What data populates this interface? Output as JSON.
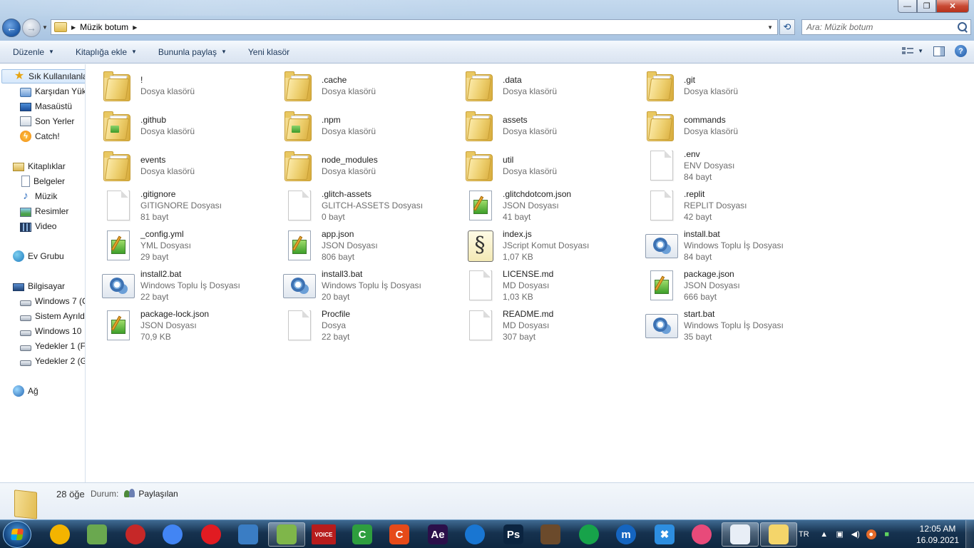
{
  "window": {
    "address_path": "Müzik botum",
    "search_placeholder": "Ara: Müzik botum",
    "minimize_symbol": "—",
    "maximize_symbol": "❐",
    "close_symbol": "✕"
  },
  "commands": [
    {
      "label": "Düzenle",
      "dropdown": true
    },
    {
      "label": "Kitaplığa ekle",
      "dropdown": true
    },
    {
      "label": "Bununla paylaş",
      "dropdown": true
    },
    {
      "label": "Yeni klasör",
      "dropdown": false
    }
  ],
  "nav": [
    {
      "label": "Sık Kullanılanlar",
      "icon": "star-icon",
      "level": 0,
      "selected": true
    },
    {
      "label": "Karşıdan Yük",
      "icon": "downloads-folder-icon",
      "level": 1
    },
    {
      "label": "Masaüstü",
      "icon": "desktop-icon",
      "level": 1
    },
    {
      "label": "Son Yerler",
      "icon": "recent-places-icon",
      "level": 1
    },
    {
      "label": "Catch!",
      "icon": "catch-icon",
      "level": 1
    },
    {
      "label": "Kitaplıklar",
      "icon": "libraries-icon",
      "level": 0
    },
    {
      "label": "Belgeler",
      "icon": "documents-icon",
      "level": 1
    },
    {
      "label": "Müzik",
      "icon": "music-icon",
      "level": 1
    },
    {
      "label": "Resimler",
      "icon": "pictures-icon",
      "level": 1
    },
    {
      "label": "Video",
      "icon": "video-icon",
      "level": 1
    },
    {
      "label": "Ev Grubu",
      "icon": "homegroup-icon",
      "level": 0
    },
    {
      "label": "Bilgisayar",
      "icon": "computer-icon",
      "level": 0
    },
    {
      "label": "Windows 7 (C",
      "icon": "windows-drive-icon",
      "level": 1
    },
    {
      "label": "Sistem Ayrıld",
      "icon": "drive-icon",
      "level": 1
    },
    {
      "label": "Windows 10",
      "icon": "drive-icon",
      "level": 1
    },
    {
      "label": "Yedekler 1 (F",
      "icon": "drive-icon",
      "level": 1
    },
    {
      "label": "Yedekler 2 (G",
      "icon": "drive-icon",
      "level": 1
    },
    {
      "label": "Ağ",
      "icon": "network-icon",
      "level": 0
    }
  ],
  "files": [
    {
      "name": "!",
      "type": "Dosya klasörü",
      "size": "",
      "icon": "folder-icon"
    },
    {
      "name": ".cache",
      "type": "Dosya klasörü",
      "size": "",
      "icon": "folder-icon"
    },
    {
      "name": ".data",
      "type": "Dosya klasörü",
      "size": "",
      "icon": "folder-icon"
    },
    {
      "name": ".git",
      "type": "Dosya klasörü",
      "size": "",
      "icon": "folder-icon"
    },
    {
      "name": ".github",
      "type": "Dosya klasörü",
      "size": "",
      "icon": "folder-icon"
    },
    {
      "name": ".npm",
      "type": "Dosya klasörü",
      "size": "",
      "icon": "folder-icon"
    },
    {
      "name": "assets",
      "type": "Dosya klasörü",
      "size": "",
      "icon": "folder-icon"
    },
    {
      "name": "commands",
      "type": "Dosya klasörü",
      "size": "",
      "icon": "folder-icon"
    },
    {
      "name": "events",
      "type": "Dosya klasörü",
      "size": "",
      "icon": "folder-icon"
    },
    {
      "name": "node_modules",
      "type": "Dosya klasörü",
      "size": "",
      "icon": "folder-icon"
    },
    {
      "name": "util",
      "type": "Dosya klasörü",
      "size": "",
      "icon": "folder-icon"
    },
    {
      "name": ".env",
      "type": "ENV Dosyası",
      "size": "84 bayt",
      "icon": "blank-file-icon"
    },
    {
      "name": ".gitignore",
      "type": "GITIGNORE Dosyası",
      "size": "81 bayt",
      "icon": "blank-file-icon"
    },
    {
      "name": ".glitch-assets",
      "type": "GLITCH-ASSETS Dosyası",
      "size": "0 bayt",
      "icon": "blank-file-icon"
    },
    {
      "name": ".glitchdotcom.json",
      "type": "JSON Dosyası",
      "size": "41 bayt",
      "icon": "json-file-icon"
    },
    {
      "name": ".replit",
      "type": "REPLIT Dosyası",
      "size": "42 bayt",
      "icon": "blank-file-icon"
    },
    {
      "name": "_config.yml",
      "type": "YML Dosyası",
      "size": "29 bayt",
      "icon": "json-file-icon"
    },
    {
      "name": "app.json",
      "type": "JSON Dosyası",
      "size": "806 bayt",
      "icon": "json-file-icon"
    },
    {
      "name": "index.js",
      "type": "JScript Komut Dosyası",
      "size": "1,07 KB",
      "icon": "script-file-icon"
    },
    {
      "name": "install.bat",
      "type": "Windows Toplu İş Dosyası",
      "size": "84 bayt",
      "icon": "batch-file-icon"
    },
    {
      "name": "install2.bat",
      "type": "Windows Toplu İş Dosyası",
      "size": "22 bayt",
      "icon": "batch-file-icon"
    },
    {
      "name": "install3.bat",
      "type": "Windows Toplu İş Dosyası",
      "size": "20 bayt",
      "icon": "batch-file-icon"
    },
    {
      "name": "LICENSE.md",
      "type": "MD Dosyası",
      "size": "1,03 KB",
      "icon": "blank-file-icon"
    },
    {
      "name": "package.json",
      "type": "JSON Dosyası",
      "size": "666 bayt",
      "icon": "json-file-icon"
    },
    {
      "name": "package-lock.json",
      "type": "JSON Dosyası",
      "size": "70,9 KB",
      "icon": "json-file-icon"
    },
    {
      "name": "Procfile",
      "type": "Dosya",
      "size": "22 bayt",
      "icon": "blank-file-icon"
    },
    {
      "name": "README.md",
      "type": "MD Dosyası",
      "size": "307 bayt",
      "icon": "blank-file-icon"
    },
    {
      "name": "start.bat",
      "type": "Windows Toplu İş Dosyası",
      "size": "35 bayt",
      "icon": "batch-file-icon"
    }
  ],
  "details": {
    "count": "28 öğe",
    "status_label": "Durum:",
    "status_value": "Paylaşılan"
  },
  "taskbar": {
    "apps": [
      {
        "name": "archicad-icon",
        "label": "",
        "color": "#f4b400",
        "round": true
      },
      {
        "name": "weather-folder-icon",
        "label": "",
        "color": "#6aa84f",
        "round": false
      },
      {
        "name": "chrome-canary-icon",
        "label": "",
        "color": "#c62828",
        "round": true
      },
      {
        "name": "chrome-icon",
        "label": "",
        "color": "#4285f4",
        "round": true
      },
      {
        "name": "opera-icon",
        "label": "",
        "color": "#e11b22",
        "round": true
      },
      {
        "name": "screen-capture-icon",
        "label": "",
        "color": "#3a7dc4",
        "round": false
      },
      {
        "name": "notepad-plus-icon",
        "label": "",
        "color": "#7fb64a",
        "round": false
      },
      {
        "name": "voicemeeter-icon",
        "label": "VOICE",
        "color": "#b71c1c",
        "round": false
      },
      {
        "name": "camtasia-icon",
        "label": "C",
        "color": "#2e9e3e",
        "round": false
      },
      {
        "name": "camtasia-recorder-icon",
        "label": "C",
        "color": "#e64a19",
        "round": false
      },
      {
        "name": "after-effects-icon",
        "label": "Ae",
        "color": "#2b0f4a",
        "round": false
      },
      {
        "name": "accessibility-icon",
        "label": "",
        "color": "#1976d2",
        "round": true
      },
      {
        "name": "photoshop-icon",
        "label": "Ps",
        "color": "#0b2440",
        "round": false
      },
      {
        "name": "minecraft-icon",
        "label": "",
        "color": "#6b4a2b",
        "round": false
      },
      {
        "name": "pdf-viewer-icon",
        "label": "",
        "color": "#17a34a",
        "round": true
      },
      {
        "name": "m-app-icon",
        "label": "m",
        "color": "#1565c0",
        "round": true
      },
      {
        "name": "tool-icon",
        "label": "✖",
        "color": "#2d8ee0",
        "round": false
      },
      {
        "name": "slime-icon",
        "label": "",
        "color": "#e84a7a",
        "round": true
      },
      {
        "name": "snipping-tool-icon",
        "label": "",
        "color": "#e8eef6",
        "round": false
      },
      {
        "name": "explorer-icon",
        "label": "",
        "color": "#f4d56a",
        "round": false
      }
    ],
    "lang": "TR",
    "time": "12:05 AM",
    "date": "16.09.2021"
  }
}
